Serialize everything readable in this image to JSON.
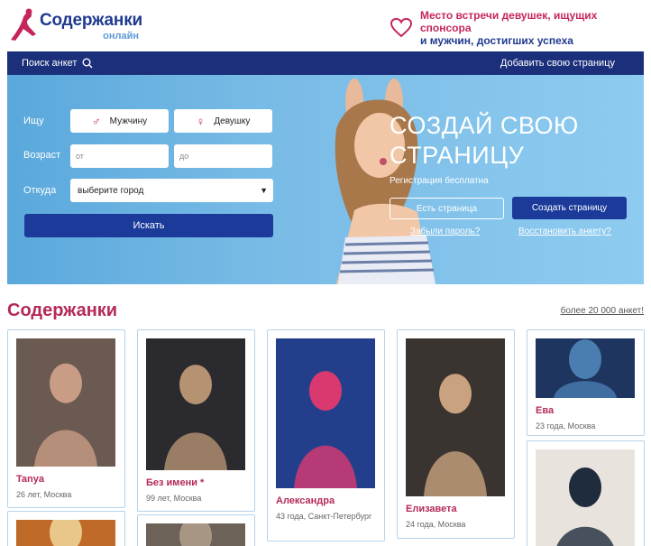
{
  "header": {
    "logo_main": "Содержанки",
    "logo_sub": "онлайн",
    "tagline_line1": "Место встречи девушек, ищущих спонсора",
    "tagline_line2": "и мужчин, достигших успеха"
  },
  "nav": {
    "search_label": "Поиск анкет",
    "add_label": "Добавить свою страницу"
  },
  "search_form": {
    "seek_label": "Ищу",
    "male_label": "Мужчину",
    "female_label": "Девушку",
    "age_label": "Возраст",
    "age_from_placeholder": "от",
    "age_to_placeholder": "до",
    "from_label": "Откуда",
    "city_value": "выберите город",
    "search_button": "Искать"
  },
  "cta": {
    "title": "СОЗДАЙ СВОЮ СТРАНИЦУ",
    "subtitle": "Регистрация бесплатна",
    "have_page": "Есть страница",
    "create_page": "Создать страницу",
    "forgot_password": "Забыли пароль?",
    "restore_profile": "Восстановить анкету?"
  },
  "section": {
    "title": "Содержанки",
    "more_link": "более 20 000 анкет!"
  },
  "profiles": [
    {
      "name": "Tanya",
      "meta": "26 лет, Москва",
      "colors": [
        "#6b5a52",
        "#c99c86"
      ],
      "photo_h": 142
    },
    {
      "name": "Без имени *",
      "meta": "99 лет, Москва",
      "colors": [
        "#2b2b2f",
        "#b59272"
      ],
      "photo_h": 146
    },
    {
      "name": "Александра",
      "meta": "43 года, Санкт-Петербург",
      "colors": [
        "#233f8c",
        "#d9396f"
      ],
      "photo_h": 166
    },
    {
      "name": "Елизавета",
      "meta": "24 года, Москва",
      "colors": [
        "#3a3430",
        "#c9a27f"
      ],
      "photo_h": 175
    },
    {
      "name": "Ева",
      "meta": "23 года, Москва",
      "colors": [
        "#1e3560",
        "#4a7db0"
      ],
      "photo_h": 66
    }
  ],
  "profiles_partial": [
    {
      "colors": [
        "#c06a2a",
        "#e9c78b"
      ]
    },
    {
      "colors": [
        "#6d6258",
        "#a89685"
      ]
    },
    {
      "colors": [
        "#e9e3dd",
        "#1e2c3d"
      ]
    }
  ]
}
